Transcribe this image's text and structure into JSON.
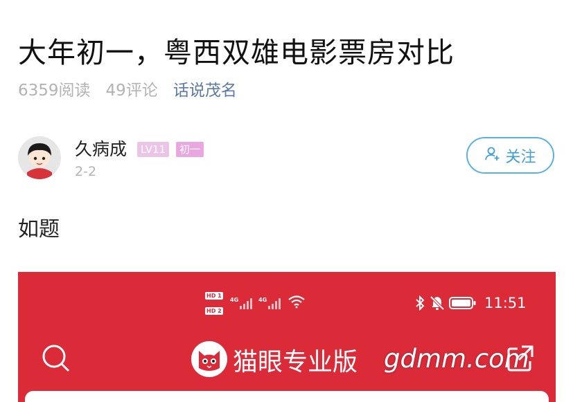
{
  "article": {
    "title": "大年初一，粤西双雄电影票房对比",
    "views": "6359阅读",
    "comments": "49评论",
    "topic": "话说茂名"
  },
  "author": {
    "name": "久病成",
    "level": "LV11",
    "tag": "初一",
    "date": "2-2",
    "follow_label": "关注"
  },
  "post": {
    "text": "如题"
  },
  "screenshot": {
    "status": {
      "sim1": "HD 1",
      "sim2": "HD 2",
      "net1": "4G",
      "net2": "4G",
      "time": "11:51"
    },
    "app_title": "猫眼专业版",
    "watermark": "gdmm.com"
  },
  "colors": {
    "accent_blue": "#3e9fd9",
    "topic_link": "#5b7aa8",
    "app_red": "#db2b39",
    "badge_pink": "#e8a7e0"
  },
  "icons": [
    "avatar",
    "user-plus-icon",
    "signal-icon",
    "wifi-icon",
    "bluetooth-icon",
    "mute-icon",
    "battery-icon",
    "search-icon",
    "cat-logo-icon",
    "share-icon"
  ]
}
